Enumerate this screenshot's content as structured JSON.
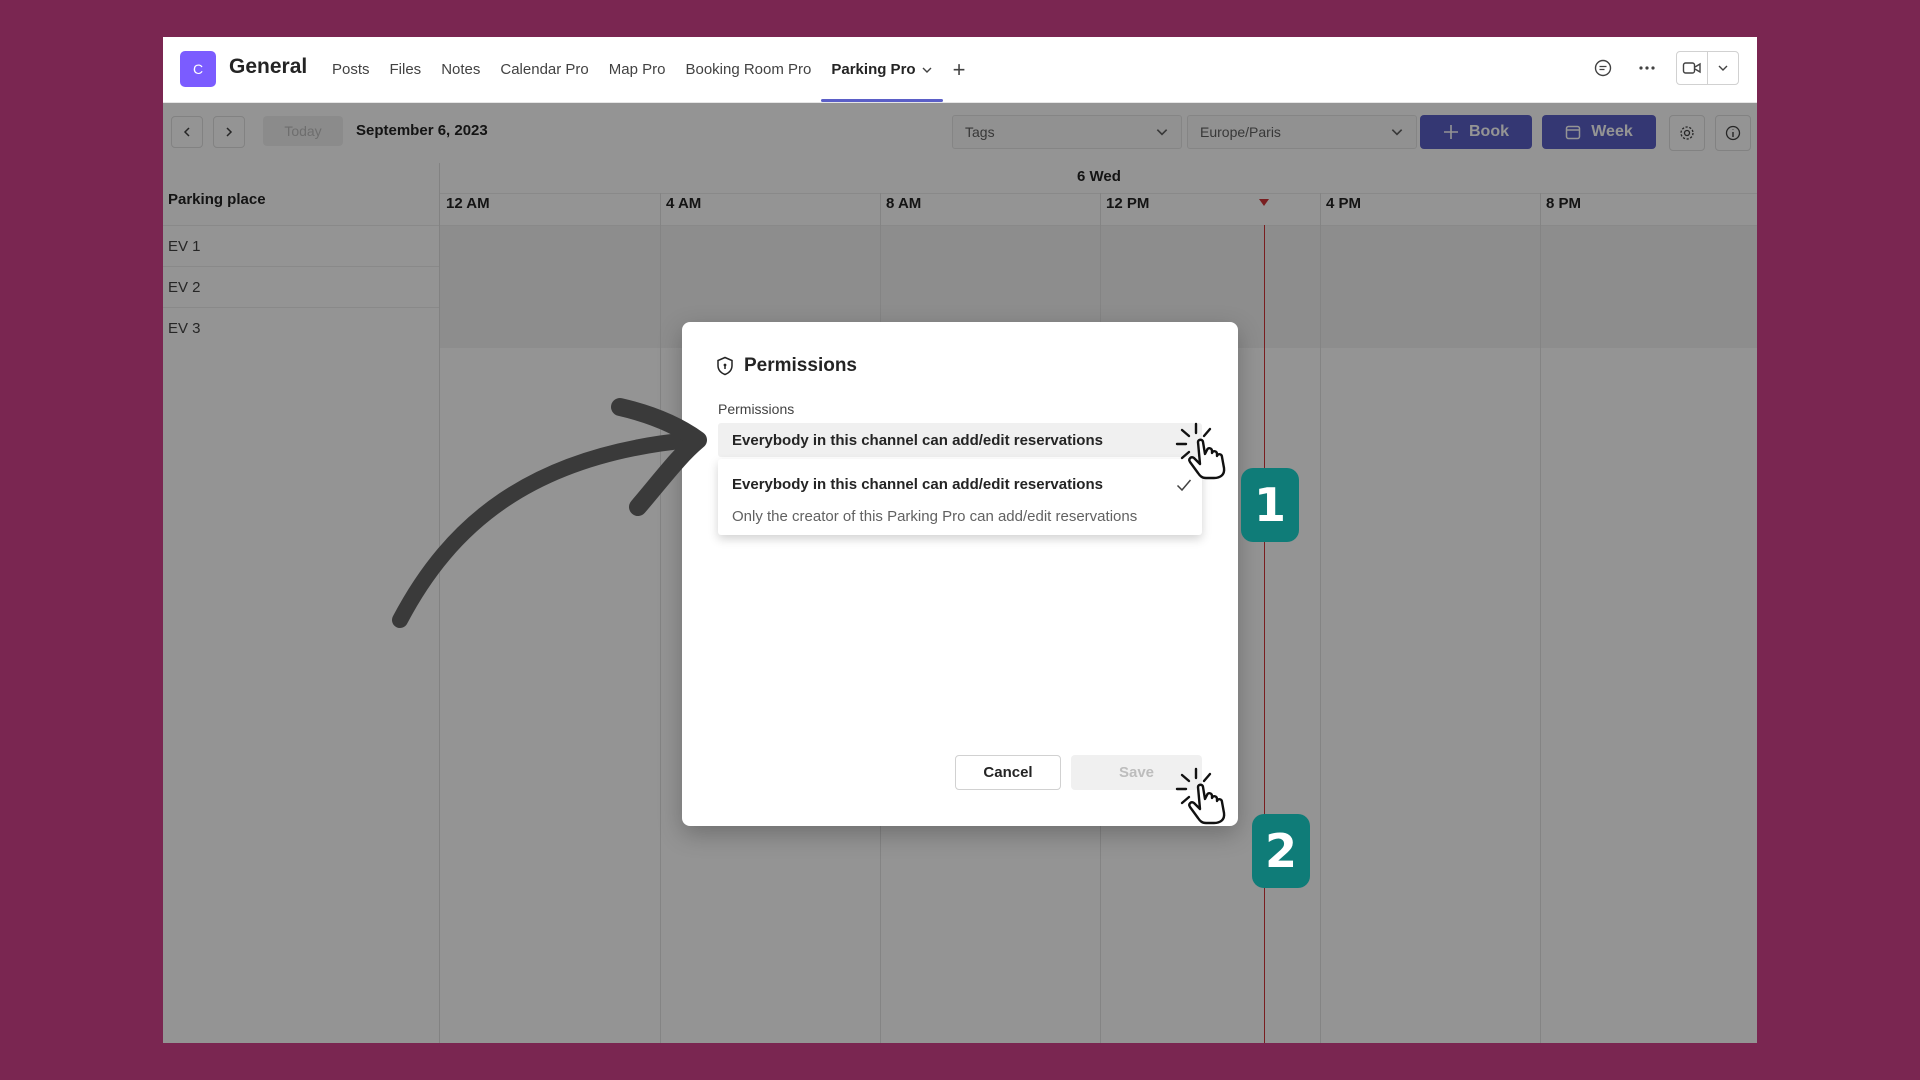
{
  "header": {
    "team_initial": "C",
    "channel": "General",
    "tabs": [
      {
        "label": "Posts"
      },
      {
        "label": "Files"
      },
      {
        "label": "Notes"
      },
      {
        "label": "Calendar Pro"
      },
      {
        "label": "Map Pro"
      },
      {
        "label": "Booking Room Pro"
      },
      {
        "label": "Parking Pro",
        "active": true
      }
    ],
    "add_tab": "+"
  },
  "toolbar": {
    "today": "Today",
    "date": "September 6, 2023",
    "tags_placeholder": "Tags",
    "timezone": "Europe/Paris",
    "book_label": "Book",
    "view_label": "Week"
  },
  "scheduler": {
    "resource_header": "Parking place",
    "resources": [
      "EV 1",
      "EV 2",
      "EV 3"
    ],
    "day": "6 Wed",
    "times": [
      "12 AM",
      "4 AM",
      "8 AM",
      "12 PM",
      "4 PM",
      "8 PM"
    ]
  },
  "dialog": {
    "title": "Permissions",
    "field_label": "Permissions",
    "selected_value": "Everybody in this channel can add/edit reservations",
    "options": [
      {
        "label": "Everybody in this channel can add/edit reservations",
        "selected": true
      },
      {
        "label": "Only the creator of this Parking Pro can add/edit reservations",
        "selected": false
      }
    ],
    "cancel_label": "Cancel",
    "save_label": "Save"
  },
  "annotations": {
    "step1": "1",
    "step2": "2"
  },
  "colors": {
    "background": "#7a2651",
    "accent": "#5b5fc7",
    "badge": "#0f7c78",
    "now_line": "#d13438"
  }
}
